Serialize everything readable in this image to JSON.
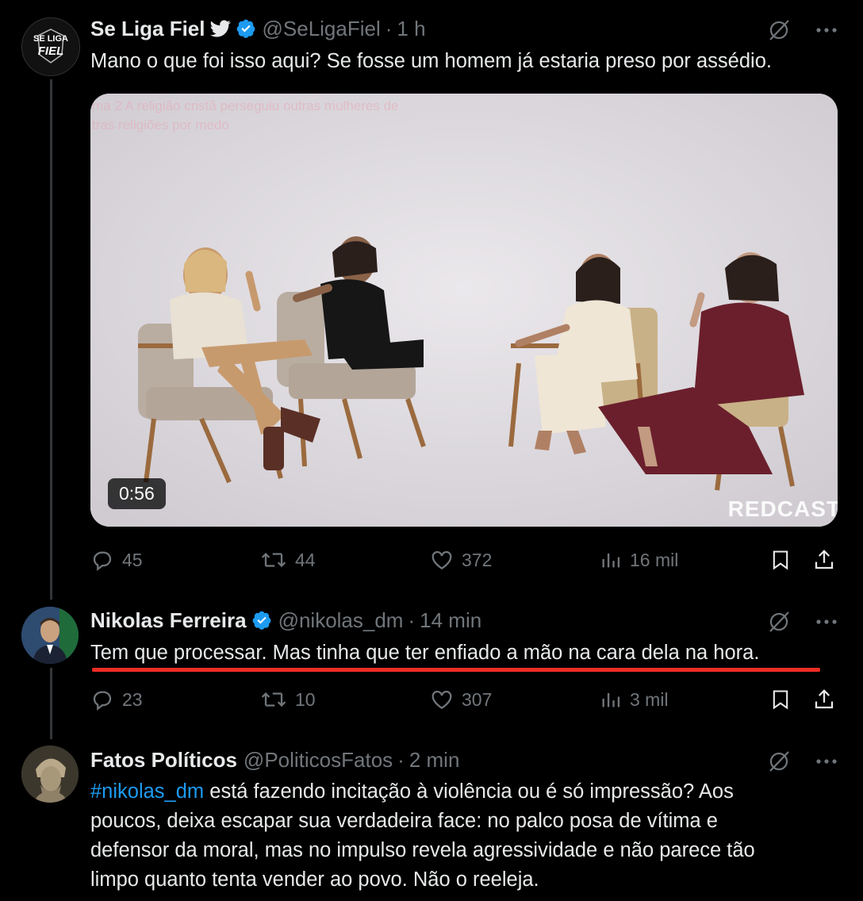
{
  "tweets": [
    {
      "name": "Se Liga Fiel",
      "handle": "@SeLigaFiel",
      "time": "1 h",
      "avatar_text_top": "SE LIGA",
      "avatar_text_bottom": "FIEL",
      "text": "Mano o que foi isso aqui? Se fosse um homem já estaria preso por assédio.",
      "media": {
        "duration": "0:56",
        "overlay_line1": "ma  2  A religião cristã perseguiu outras mulheres de",
        "overlay_line2": "tras religiões por medo",
        "watermark": "REDCAST"
      },
      "stats": {
        "replies": "45",
        "retweets": "44",
        "likes": "372",
        "views": "16 mil"
      }
    },
    {
      "name": "Nikolas Ferreira",
      "handle": "@nikolas_dm",
      "time": "14 min",
      "text": "Tem que processar. Mas tinha que ter enfiado a mão na cara dela na hora.",
      "stats": {
        "replies": "23",
        "retweets": "10",
        "likes": "307",
        "views": "3 mil"
      }
    },
    {
      "name": "Fatos Políticos",
      "handle": "@PoliticosFatos",
      "time": "2 min",
      "hashtag": "#nikolas_dm",
      "text_line1": " está fazendo incitação à violência ou é só impressão? Aos",
      "text_line2": "poucos, deixa escapar sua verdadeira face: no palco posa de vítima e",
      "text_line3": "defensor da moral, mas no impulso revela agressividade e não parece tão",
      "text_line4": "limpo quanto tenta vender ao povo. Não o reeleja."
    }
  ],
  "colors": {
    "accent": "#1d9bf0",
    "muted": "#71767b",
    "underline": "#ee2d24",
    "background": "#000000"
  },
  "icons": [
    "twitter-bird-icon",
    "verified-badge-icon",
    "grok-icon",
    "more-icon",
    "reply-icon",
    "retweet-icon",
    "like-icon",
    "views-icon",
    "bookmark-icon",
    "share-icon"
  ]
}
